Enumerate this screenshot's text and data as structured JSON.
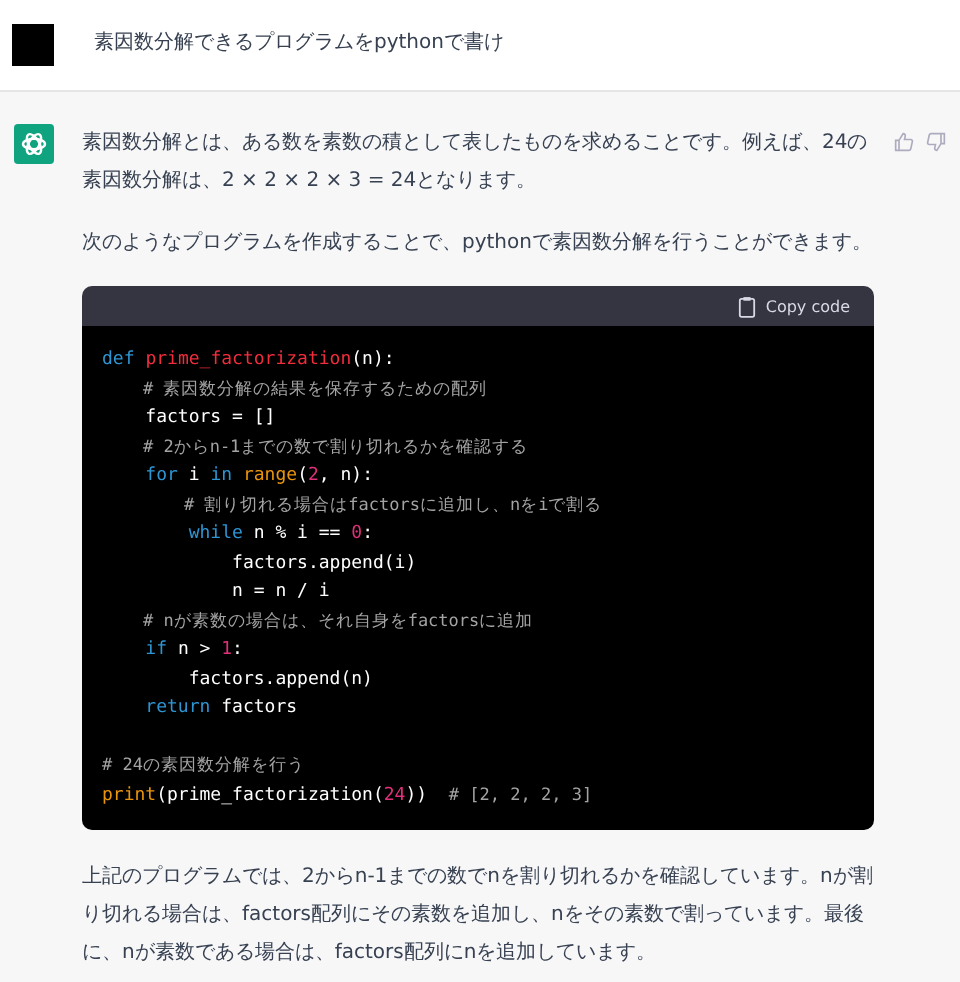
{
  "user_message": {
    "text": "素因数分解できるプログラムをpythonで書け"
  },
  "assistant_message": {
    "paragraphs_before": [
      "素因数分解とは、ある数を素数の積として表したものを求めることです。例えば、24の素因数分解は、2 × 2 × 2 × 3 = 24となります。",
      "次のようなプログラムを作成することで、pythonで素因数分解を行うことができます。"
    ],
    "code_block": {
      "copy_button": "Copy code",
      "lines": [
        {
          "tokens": [
            {
              "kind": "keyword",
              "text": "def "
            },
            {
              "kind": "function",
              "text": "prime_factorization"
            },
            {
              "kind": "plain",
              "text": "(n):"
            }
          ]
        },
        {
          "tokens": [
            {
              "kind": "comment",
              "text": "    # 素因数分解の結果を保存するための配列"
            }
          ]
        },
        {
          "tokens": [
            {
              "kind": "plain",
              "text": "    factors = []"
            }
          ]
        },
        {
          "tokens": [
            {
              "kind": "comment",
              "text": "    # 2からn-1までの数で割り切れるかを確認する"
            }
          ]
        },
        {
          "tokens": [
            {
              "kind": "keyword",
              "text": "    for "
            },
            {
              "kind": "plain",
              "text": "i "
            },
            {
              "kind": "keyword",
              "text": "in "
            },
            {
              "kind": "builtin",
              "text": "range"
            },
            {
              "kind": "plain",
              "text": "("
            },
            {
              "kind": "number",
              "text": "2"
            },
            {
              "kind": "plain",
              "text": ", n):"
            }
          ]
        },
        {
          "tokens": [
            {
              "kind": "comment",
              "text": "        # 割り切れる場合はfactorsに追加し、nをiで割る"
            }
          ]
        },
        {
          "tokens": [
            {
              "kind": "keyword",
              "text": "        while "
            },
            {
              "kind": "plain",
              "text": "n % i == "
            },
            {
              "kind": "number",
              "text": "0"
            },
            {
              "kind": "plain",
              "text": ":"
            }
          ]
        },
        {
          "tokens": [
            {
              "kind": "plain",
              "text": "            factors.append(i)"
            }
          ]
        },
        {
          "tokens": [
            {
              "kind": "plain",
              "text": "            n = n / i"
            }
          ]
        },
        {
          "tokens": [
            {
              "kind": "comment",
              "text": "    # nが素数の場合は、それ自身をfactorsに追加"
            }
          ]
        },
        {
          "tokens": [
            {
              "kind": "keyword",
              "text": "    if "
            },
            {
              "kind": "plain",
              "text": "n > "
            },
            {
              "kind": "number",
              "text": "1"
            },
            {
              "kind": "plain",
              "text": ":"
            }
          ]
        },
        {
          "tokens": [
            {
              "kind": "plain",
              "text": "        factors.append(n)"
            }
          ]
        },
        {
          "tokens": [
            {
              "kind": "keyword",
              "text": "    return "
            },
            {
              "kind": "plain",
              "text": "factors"
            }
          ]
        },
        {
          "blank_line_before": true,
          "tokens": [
            {
              "kind": "comment",
              "text": "# 24の素因数分解を行う"
            }
          ]
        },
        {
          "tokens": [
            {
              "kind": "builtin",
              "text": "print"
            },
            {
              "kind": "plain",
              "text": "(prime_factorization("
            },
            {
              "kind": "number",
              "text": "24"
            },
            {
              "kind": "plain",
              "text": "))  "
            },
            {
              "kind": "comment",
              "text": "# [2, 2, 2, 3]"
            }
          ]
        }
      ]
    },
    "paragraphs_after": [
      "上記のプログラムでは、2からn-1までの数でnを割り切れるかを確認しています。nが割り切れる場合は、factors配列にその素数を追加し、nをその素数で割っています。最後に、nが素数である場合は、factors配列にnを追加しています。"
    ]
  }
}
